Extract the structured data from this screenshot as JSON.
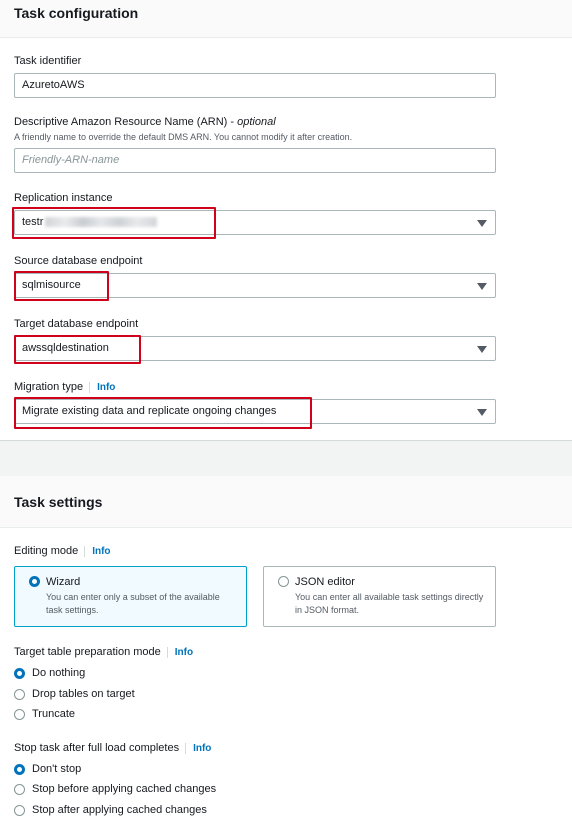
{
  "task_config": {
    "title": "Task configuration",
    "task_identifier": {
      "label": "Task identifier",
      "value": "AzuretoAWS"
    },
    "arn": {
      "label": "Descriptive Amazon Resource Name (ARN) - ",
      "optional": "optional",
      "description": "A friendly name to override the default DMS ARN. You cannot modify it after creation.",
      "placeholder": "Friendly-ARN-name"
    },
    "replication_instance": {
      "label": "Replication instance",
      "value": "testr"
    },
    "source_endpoint": {
      "label": "Source database endpoint",
      "value": "sqlmisource"
    },
    "target_endpoint": {
      "label": "Target database endpoint",
      "value": "awssqldestination"
    },
    "migration_type": {
      "label": "Migration type",
      "info": "Info",
      "value": "Migrate existing data and replicate ongoing changes"
    }
  },
  "task_settings": {
    "title": "Task settings",
    "editing_mode": {
      "label": "Editing mode",
      "info": "Info",
      "options": [
        {
          "title": "Wizard",
          "description": "You can enter only a subset of the available task settings.",
          "selected": true
        },
        {
          "title": "JSON editor",
          "description": "You can enter all available task settings directly in JSON format.",
          "selected": false
        }
      ]
    },
    "table_prep": {
      "label": "Target table preparation mode",
      "info": "Info",
      "options": [
        "Do nothing",
        "Drop tables on target",
        "Truncate"
      ],
      "selected": "Do nothing"
    },
    "stop_task": {
      "label": "Stop task after full load completes",
      "info": "Info",
      "options": [
        "Don't stop",
        "Stop before applying cached changes",
        "Stop after applying cached changes"
      ],
      "selected": "Don't stop"
    }
  },
  "colors": {
    "accent": "#0073bb",
    "highlight": "#d0021b",
    "tile_selected": "#00a1c9"
  }
}
